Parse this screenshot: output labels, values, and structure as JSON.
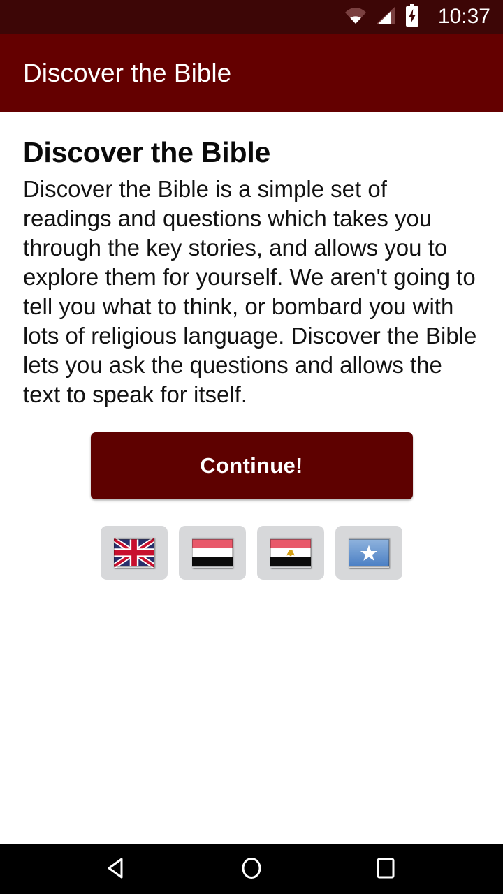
{
  "status_bar": {
    "time": "10:37",
    "icons": [
      {
        "name": "wifi-icon",
        "label": "wifi"
      },
      {
        "name": "cellular-signal-icon",
        "label": "signal"
      },
      {
        "name": "battery-charging-icon",
        "label": "battery charging"
      }
    ],
    "background_color": "#3d0606",
    "foreground_color": "#ffffff"
  },
  "app_bar": {
    "title": "Discover the Bible",
    "background_color": "#640000",
    "title_color": "#ffffff"
  },
  "content": {
    "heading": "Discover the Bible",
    "body": "Discover the Bible is a simple set of readings and questions which takes you through the key stories, and allows you to explore them for yourself. We aren't going to tell you what to think, or bombard you with lots of religious language. Discover the Bible lets you ask the questions and allows the text to speak for itself.",
    "continue_label": "Continue!",
    "continue_color": "#5e0100",
    "background_color": "#ffffff"
  },
  "language_selector": {
    "button_background": "#d7d8da",
    "flags": [
      {
        "name": "flag-button-united-kingdom",
        "icon": "flag-uk-icon",
        "label": "United Kingdom"
      },
      {
        "name": "flag-button-yemen",
        "icon": "flag-yemen-icon",
        "label": "Yemen"
      },
      {
        "name": "flag-button-egypt",
        "icon": "flag-egypt-icon",
        "label": "Egypt"
      },
      {
        "name": "flag-button-somalia",
        "icon": "flag-somalia-icon",
        "label": "Somalia"
      }
    ]
  },
  "nav_bar": {
    "background_color": "#000000",
    "buttons": [
      {
        "name": "nav-back-button",
        "icon": "back-triangle-icon",
        "label": "Back"
      },
      {
        "name": "nav-home-button",
        "icon": "home-circle-icon",
        "label": "Home"
      },
      {
        "name": "nav-recents-button",
        "icon": "recents-square-icon",
        "label": "Recents"
      }
    ]
  }
}
